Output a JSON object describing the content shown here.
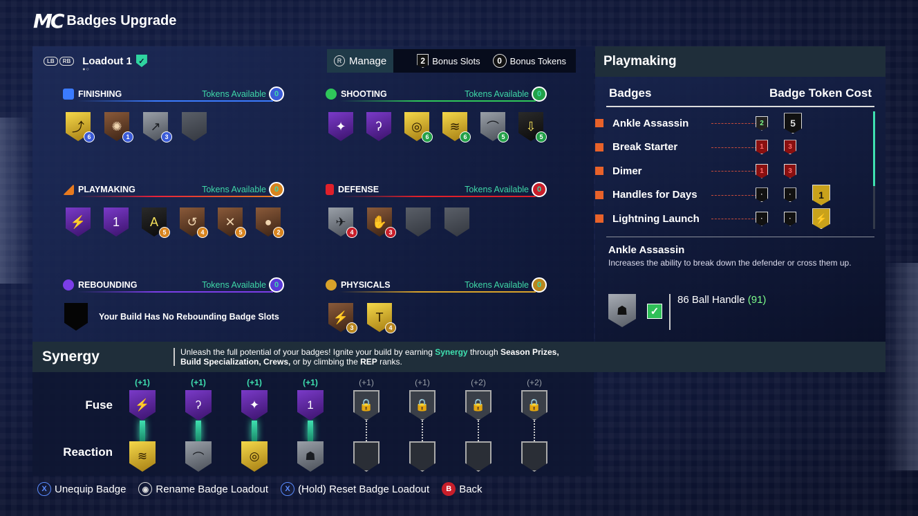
{
  "header": {
    "logo": "MC",
    "title": "Badges Upgrade"
  },
  "loadout": {
    "lb": "LB",
    "rb": "RB",
    "name": "Loadout 1",
    "dots": "●○",
    "manage_icon": "R",
    "manage_label": "Manage",
    "bonus_slots_value": "2",
    "bonus_slots_label": "Bonus Slots",
    "bonus_tokens_value": "0",
    "bonus_tokens_label": "Bonus Tokens"
  },
  "categories": {
    "finishing": {
      "label": "FINISHING",
      "tokens_label": "Tokens Available",
      "tokens": "0",
      "color": "#3b7bff"
    },
    "shooting": {
      "label": "SHOOTING",
      "tokens_label": "Tokens Available",
      "tokens": "0",
      "color": "#2fc65a"
    },
    "playmaking": {
      "label": "PLAYMAKING",
      "tokens_label": "Tokens Available",
      "tokens": "0",
      "color": "#e87a1e"
    },
    "defense": {
      "label": "DEFENSE",
      "tokens_label": "Tokens Available",
      "tokens": "0",
      "color": "#e0202a"
    },
    "rebounding": {
      "label": "REBOUNDING",
      "tokens_label": "Tokens Available",
      "tokens": "0",
      "color": "#7b3ee8",
      "empty_message": "Your Build Has No Rebounding Badge Slots"
    },
    "physicals": {
      "label": "PHYSICALS",
      "tokens_label": "Tokens Available",
      "tokens": "0",
      "color": "#d8a22a"
    }
  },
  "badge_levels": {
    "finishing": [
      "6",
      "1",
      "3"
    ],
    "shooting": [
      "6",
      "6",
      "5",
      "5"
    ],
    "playmaking": [
      "5",
      "4",
      "5",
      "2"
    ],
    "defense": [
      "4",
      "3"
    ],
    "physicals": [
      "3",
      "4"
    ]
  },
  "right_panel": {
    "title": "Playmaking",
    "col_badges": "Badges",
    "col_cost": "Badge Token Cost",
    "rows": [
      {
        "name": "Ankle Assassin",
        "cost1": "2",
        "cost2": "5"
      },
      {
        "name": "Break Starter",
        "cost1": "1",
        "cost2": "3"
      },
      {
        "name": "Dimer",
        "cost1": "1",
        "cost2": "3"
      },
      {
        "name": "Handles for Days",
        "cost1": "",
        "cost2": ""
      },
      {
        "name": "Lightning Launch",
        "cost1": "",
        "cost2": ""
      }
    ],
    "selected_name": "Ankle Assassin",
    "selected_desc": "Increases the ability to break down the defender or cross them up.",
    "requirement": "86 Ball Handle",
    "requirement_current": "(91)"
  },
  "synergy": {
    "title": "Synergy",
    "text_1": "Unleash the full potential of your badges! Ignite your build by earning ",
    "text_highlight": "Synergy",
    "text_2": " through ",
    "text_b1": "Season Prizes, Build Specialization, Crews,",
    "text_3": " or by climbing the ",
    "text_b2": "REP",
    "text_4": " ranks.",
    "fuse_label": "Fuse",
    "reaction_label": "Reaction",
    "plus": [
      "(+1)",
      "(+1)",
      "(+1)",
      "(+1)",
      "(+1)",
      "(+1)",
      "(+2)",
      "(+2)"
    ]
  },
  "footer": {
    "unequip": "Unequip Badge",
    "rename": "Rename Badge Loadout",
    "reset": "(Hold) Reset Badge Loadout",
    "back": "Back",
    "x_icon": "X",
    "b_icon": "B"
  }
}
